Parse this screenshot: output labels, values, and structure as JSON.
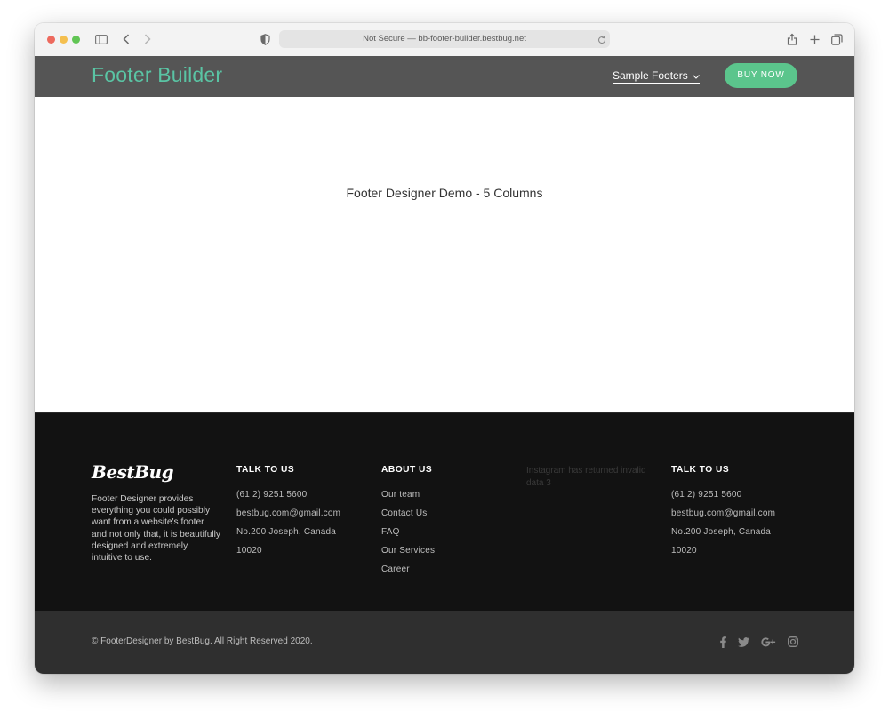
{
  "browser": {
    "address": "Not Secure — bb-footer-builder.bestbug.net",
    "traffic_lights": [
      "#ed6a5e",
      "#f4bf4f",
      "#61c554"
    ]
  },
  "header": {
    "logo": "Footer Builder",
    "menu_label": "Sample Footers",
    "buy_label": "BUY NOW"
  },
  "main": {
    "title": "Footer Designer Demo - 5 Columns"
  },
  "footer": {
    "brand": "BestBug",
    "about_text": "Footer Designer provides everything you could possibly want from a website's footer and not only that, it is beautifully designed and extremely intuitive to use.",
    "col1": {
      "title": "TALK TO US",
      "items": [
        "(61 2) 9251 5600",
        "bestbug.com@gmail.com",
        "No.200 Joseph, Canada",
        "10020"
      ]
    },
    "col2": {
      "title": "ABOUT US",
      "items": [
        "Our team",
        "Contact Us",
        "FAQ",
        "Our Services",
        "Career"
      ]
    },
    "instagram_message": "Instagram has returned invalid data 3",
    "col4": {
      "title": "TALK TO US",
      "items": [
        "(61 2) 9251 5600",
        "bestbug.com@gmail.com",
        "No.200 Joseph, Canada",
        "10020"
      ]
    }
  },
  "bottom": {
    "copyright": "© FooterDesigner by BestBug. All Right Reserved 2020.",
    "social_icons": [
      "facebook-icon",
      "twitter-icon",
      "google-plus-icon",
      "instagram-icon"
    ]
  },
  "colors": {
    "accent": "#5ac4a4",
    "button": "#5bc58c",
    "header_bg": "#555555",
    "footer_bg": "#121212"
  }
}
